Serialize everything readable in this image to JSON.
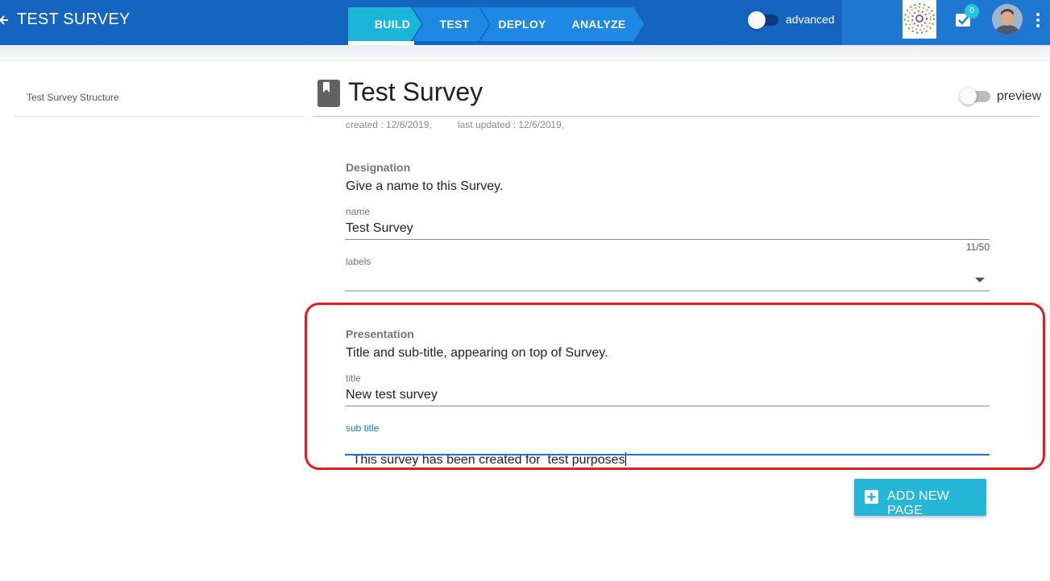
{
  "header": {
    "title": "TEST SURVEY",
    "steps": [
      {
        "label": "BUILD",
        "active": true
      },
      {
        "label": "TEST",
        "active": false
      },
      {
        "label": "DEPLOY",
        "active": false
      },
      {
        "label": "ANALYZE",
        "active": false
      }
    ],
    "advanced_label": "advanced",
    "advanced_on": false,
    "notification_count": "0",
    "icons": [
      "back-arrow-icon",
      "checklist-icon",
      "more-vert-icon"
    ]
  },
  "sidebar": {
    "title": "Test Survey Structure"
  },
  "main": {
    "title": "Test Survey",
    "preview_label": "preview",
    "created": "created : 12/6/2019,",
    "updated": "last updated : 12/6/2019,",
    "designation": {
      "heading": "Designation",
      "description": "Give a name to this Survey.",
      "name_label": "name",
      "name_value": "Test Survey",
      "name_counter": "11/50",
      "labels_label": "labels"
    },
    "presentation": {
      "heading": "Presentation",
      "description": "Title and sub-title, appearing on top of Survey.",
      "title_label": "title",
      "title_value": "New test survey",
      "subtitle_label": "sub title",
      "subtitle_value": "This survey has been created for  test purposes"
    },
    "add_page_label": "ADD NEW PAGE"
  },
  "colors": {
    "topbar": "#1565c0",
    "step_active": "#1ab6d9",
    "step_inactive": "#1e88e5",
    "accent": "#1976d2",
    "highlight": "#e11d24",
    "button": "#26b6d8"
  }
}
